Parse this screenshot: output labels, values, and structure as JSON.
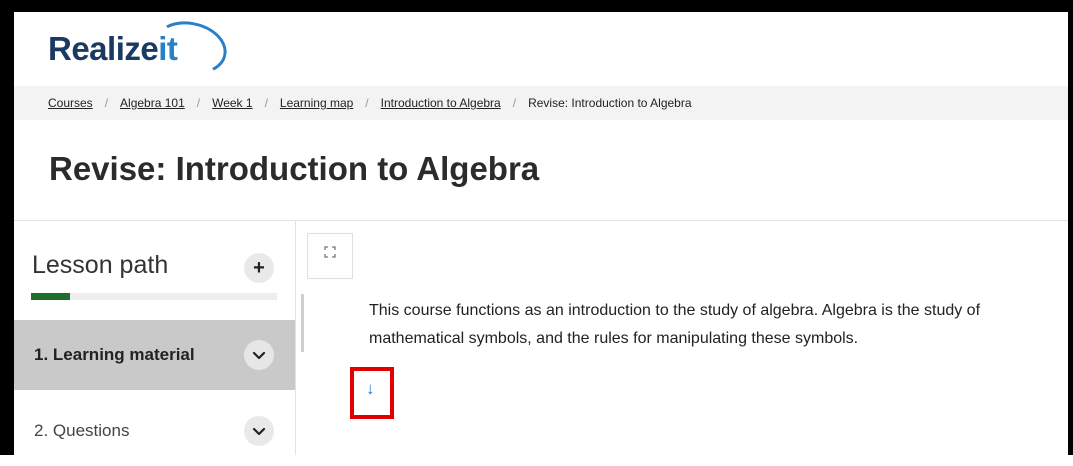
{
  "logo": {
    "text_main": "Realize",
    "text_accent": "it"
  },
  "breadcrumb": {
    "items": [
      "Courses",
      "Algebra 101",
      "Week 1",
      "Learning map",
      "Introduction to Algebra"
    ],
    "current": "Revise: Introduction to Algebra",
    "separator": "/"
  },
  "page": {
    "title": "Revise: Introduction to Algebra"
  },
  "lesson_path": {
    "title": "Lesson path",
    "add_icon": "plus-icon",
    "progress_fraction": 0.16,
    "items": [
      {
        "label": "1.  Learning material",
        "icon": "chevron-down-icon"
      },
      {
        "label": "2.  Questions",
        "icon": "chevron-down-icon"
      }
    ]
  },
  "content": {
    "expand_icon": "expand-icon",
    "paragraph": "This course functions as an introduction to the study of algebra. Algebra is the study of mathematical symbols, and the rules for manipulating these symbols.",
    "next_arrow": "↓"
  },
  "colors": {
    "brand_navy": "#1b3a63",
    "brand_blue": "#2a80c8",
    "progress": "#1e6e2b",
    "highlight": "#e00000"
  }
}
